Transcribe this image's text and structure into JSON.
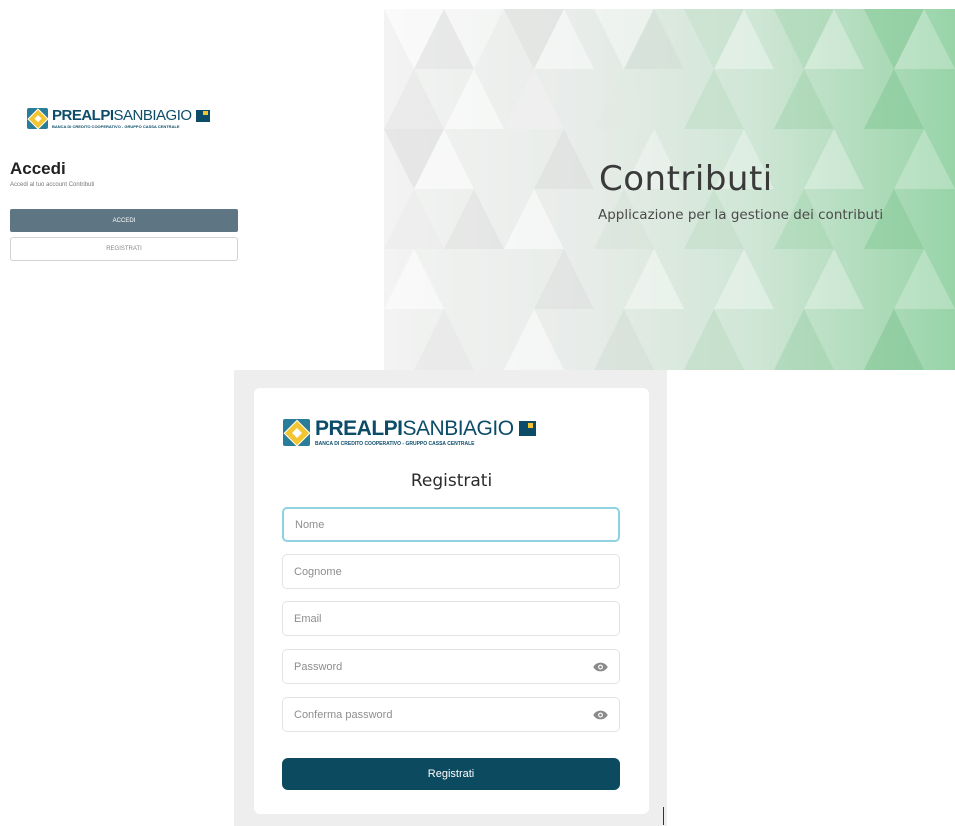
{
  "brand": {
    "name_bold": "PREALPI",
    "name_light": "SANBIAGIO",
    "tagline": "BANCA DI CREDITO COOPERATIVO - GRUPPO CASSA CENTRALE"
  },
  "login": {
    "title": "Accedi",
    "subtitle": "Accedi al tuo account Contributi",
    "accedi_label": "ACCEDI",
    "registrati_label": "REGISTRATI"
  },
  "hero": {
    "title": "Contributi",
    "subtitle": "Applicazione per la gestione dei contributi"
  },
  "register": {
    "title": "Registrati",
    "fields": {
      "nome_placeholder": "Nome",
      "cognome_placeholder": "Cognome",
      "email_placeholder": "Email",
      "password_placeholder": "Password",
      "confirm_placeholder": "Conferma password"
    },
    "submit_label": "Registrati"
  },
  "colors": {
    "primary": "#0c4a60",
    "accedi_button": "#5e7683",
    "focus_border": "#8fd3e3",
    "brand_blue": "#0d4c69",
    "brand_yellow": "#f2c531",
    "hero_green": "#98d4a8"
  },
  "icons": {
    "password_toggle": "eye-icon",
    "confirm_toggle": "eye-icon"
  }
}
